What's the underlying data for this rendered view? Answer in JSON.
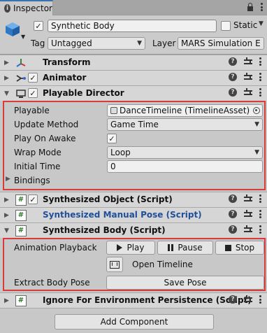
{
  "tab": {
    "title": "Inspector"
  },
  "gameobject": {
    "name": "Synthetic Body",
    "active": true,
    "static_label": "Static",
    "tag_label": "Tag",
    "tag_value": "Untagged",
    "layer_label": "Layer",
    "layer_value": "MARS Simulation E"
  },
  "components": {
    "transform": {
      "title": "Transform",
      "icon": "transform-axes-icon"
    },
    "animator": {
      "title": "Animator",
      "icon": "animator-icon",
      "enabled": true
    },
    "playable_director": {
      "title": "Playable Director",
      "icon": "playable-director-icon",
      "enabled": true,
      "playable_label": "Playable",
      "playable_value": "DanceTimeline (TimelineAsset)",
      "update_method_label": "Update Method",
      "update_method_value": "Game Time",
      "play_on_awake_label": "Play On Awake",
      "play_on_awake": true,
      "wrap_mode_label": "Wrap Mode",
      "wrap_mode_value": "Loop",
      "initial_time_label": "Initial Time",
      "initial_time_value": "0",
      "bindings_label": "Bindings"
    },
    "synthesized_object": {
      "title": "Synthesized Object (Script)",
      "enabled": true
    },
    "synthesized_manual_pose": {
      "title": "Synthesized Manual Pose (Script)"
    },
    "synthesized_body": {
      "title": "Synthesized Body (Script)",
      "animation_playback_label": "Animation Playback",
      "play_label": "Play",
      "pause_label": "Pause",
      "stop_label": "Stop",
      "open_timeline_label": "Open Timeline",
      "extract_body_pose_label": "Extract Body Pose",
      "save_pose_label": "Save Pose"
    },
    "ignore_env": {
      "title": "Ignore For Environment Persistence (Script)"
    }
  },
  "add_component_label": "Add Component",
  "colors": {
    "highlight_box": "#d93a3a",
    "manual_pose_title": "#1f4f9a"
  }
}
